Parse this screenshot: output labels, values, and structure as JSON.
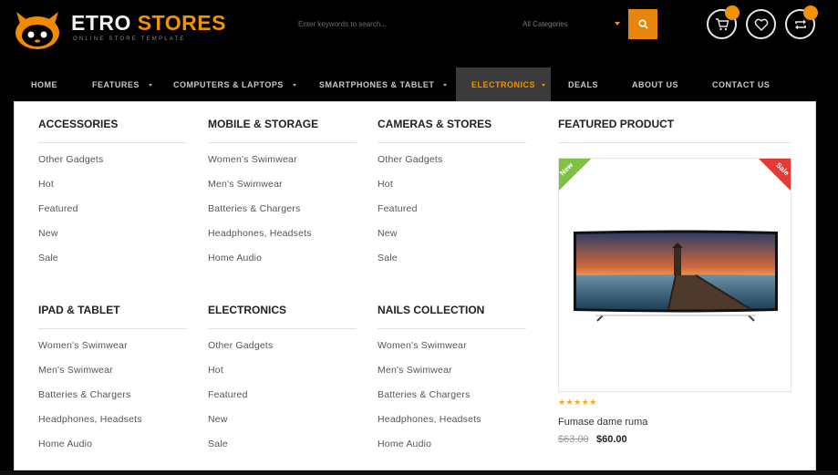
{
  "brand": {
    "name_part1": "ETRO",
    "name_part2": " STORES",
    "tagline": "ONLINE STORE TEMPLATE"
  },
  "search": {
    "placeholder": "Enter keywords to search...",
    "category": "All Categories"
  },
  "icons": [
    "cart-icon",
    "heart-icon",
    "refresh-icon",
    "search-icon"
  ],
  "nav": {
    "items": [
      {
        "label": "HOME"
      },
      {
        "label": "FEATURES"
      },
      {
        "label": "COMPUTERS & LAPTOPS"
      },
      {
        "label": "SMARTPHONES & TABLET"
      },
      {
        "label": "ELECTRONICS"
      },
      {
        "label": "DEALS"
      },
      {
        "label": "ABOUT US"
      },
      {
        "label": "CONTACT US"
      }
    ],
    "active": "ELECTRONICS"
  },
  "menu": {
    "columns": [
      {
        "title": "ACCESSORIES",
        "links": [
          "Other Gadgets",
          "Hot",
          "Featured",
          "New",
          "Sale"
        ]
      },
      {
        "title": "MOBILE & STORAGE",
        "links": [
          "Women's Swimwear",
          "Men's Swimwear",
          "Batteries & Chargers",
          "Headphones, Headsets",
          "Home Audio"
        ]
      },
      {
        "title": "CAMERAS & STORES",
        "links": [
          "Other Gadgets",
          "Hot",
          "Featured",
          "New",
          "Sale"
        ]
      },
      {
        "title": "IPAD & TABLET",
        "links": [
          "Women's Swimwear",
          "Men's Swimwear",
          "Batteries & Chargers",
          "Headphones, Headsets",
          "Home Audio"
        ]
      },
      {
        "title": "ELECTRONICS",
        "links": [
          "Other Gadgets",
          "Hot",
          "Featured",
          "New",
          "Sale"
        ]
      },
      {
        "title": "NAILS COLLECTION",
        "links": [
          "Women's Swimwear",
          "Men's Swimwear",
          "Batteries & Chargers",
          "Headphones, Headsets",
          "Home Audio"
        ]
      }
    ]
  },
  "featured": {
    "title": "FEATURED PRODUCT",
    "badge_new": "New",
    "badge_sale": "Sale",
    "stars": "★★★★★",
    "rating": 5,
    "name": "Fumase dame ruma",
    "old_price": "$63.00",
    "new_price": "$60.00"
  },
  "colors": {
    "accent": "#f39200",
    "badge_new": "#7fc241",
    "badge_sale": "#e53935",
    "nav_active_bg": "#3b3b3b"
  }
}
